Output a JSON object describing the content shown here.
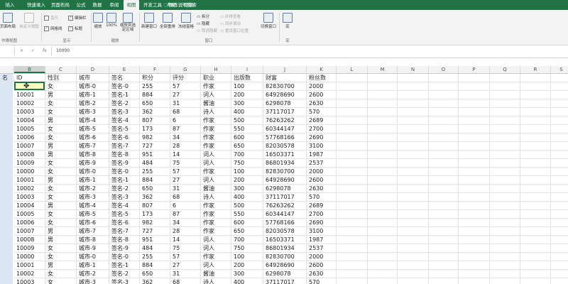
{
  "tabs": [
    {
      "label": "插入"
    },
    {
      "label": "快速录入"
    },
    {
      "label": "页面布局"
    },
    {
      "label": "公式"
    },
    {
      "label": "数据"
    },
    {
      "label": "审阅"
    },
    {
      "label": "视图",
      "active": true
    },
    {
      "label": "开发工具"
    },
    {
      "label": "帮助"
    },
    {
      "label": "团队"
    }
  ],
  "tell_me": "操作说明搜索",
  "ribbon": {
    "workbook_views": {
      "page_layout": "页面布局",
      "custom_views": "自定义视图",
      "pagebreak_view": "作簿视图"
    },
    "show": {
      "ruler": "直尺",
      "formula_bar": "编辑栏",
      "gridlines": "网格线",
      "headings": "标题",
      "group_label": "显示"
    },
    "zoom": {
      "zoom": "缩放",
      "zoom100": "100%",
      "zoom_selection": "缩放到选定区域",
      "group_label": "缩放"
    },
    "window": {
      "new_window": "新建窗口",
      "arrange_all": "全部重排",
      "freeze_panes": "冻结窗格",
      "split": "拆分",
      "hide": "隐藏",
      "unhide": "取消隐藏",
      "side_by_side": "并排查看",
      "sync_scroll": "同步滚动",
      "reset_pos": "重设窗口位置",
      "switch_windows": "切换窗口",
      "group_label": "窗口"
    },
    "macros": {
      "label": "宏",
      "group_label": "宏"
    }
  },
  "formula_bar": {
    "fx": "fx",
    "cancel": "×",
    "enter": "✓",
    "content": "10000"
  },
  "columns": [
    {
      "letter": "",
      "selected": false
    },
    {
      "letter": "B",
      "selected": true
    },
    {
      "letter": "C"
    },
    {
      "letter": "D"
    },
    {
      "letter": "E"
    },
    {
      "letter": "F"
    },
    {
      "letter": "G"
    },
    {
      "letter": "H"
    },
    {
      "letter": "I"
    },
    {
      "letter": "J"
    },
    {
      "letter": "K"
    },
    {
      "letter": "L"
    },
    {
      "letter": "M"
    },
    {
      "letter": "N"
    },
    {
      "letter": "O"
    },
    {
      "letter": "P"
    },
    {
      "letter": "Q"
    },
    {
      "letter": "R"
    },
    {
      "letter": "S"
    }
  ],
  "header_row": [
    "名",
    "ID",
    "性别",
    "城市",
    "签名",
    "积分",
    "评分",
    "职业",
    "出版数",
    "财富",
    "粉丝数"
  ],
  "rows": [
    [
      "10000",
      "女",
      "城市-0",
      "签名-0",
      "255",
      "57",
      "作家",
      "100",
      "82830700",
      "2000"
    ],
    [
      "10001",
      "男",
      "城市-1",
      "签名-1",
      "884",
      "27",
      "词人",
      "200",
      "64928690",
      "2600"
    ],
    [
      "10002",
      "女",
      "城市-2",
      "签名-2",
      "650",
      "31",
      "酱油",
      "300",
      "6298078",
      "2630"
    ],
    [
      "10003",
      "女",
      "城市-3",
      "签名-3",
      "362",
      "68",
      "诗人",
      "400",
      "37117017",
      "570"
    ],
    [
      "10004",
      "男",
      "城市-4",
      "签名-4",
      "807",
      "6",
      "作家",
      "500",
      "76263262",
      "2689"
    ],
    [
      "10005",
      "女",
      "城市-5",
      "签名-5",
      "173",
      "87",
      "作家",
      "550",
      "60344147",
      "2700"
    ],
    [
      "10006",
      "女",
      "城市-6",
      "签名-6",
      "982",
      "34",
      "作家",
      "600",
      "57768166",
      "2690"
    ],
    [
      "10007",
      "男",
      "城市-7",
      "签名-7",
      "727",
      "28",
      "作家",
      "650",
      "82030578",
      "3100"
    ],
    [
      "10008",
      "男",
      "城市-8",
      "签名-8",
      "951",
      "14",
      "词人",
      "700",
      "16503371",
      "1987"
    ],
    [
      "10009",
      "女",
      "城市-9",
      "签名-9",
      "484",
      "75",
      "词人",
      "750",
      "86801934",
      "2537"
    ],
    [
      "10000",
      "女",
      "城市-0",
      "签名-0",
      "255",
      "57",
      "作家",
      "100",
      "82830700",
      "2000"
    ],
    [
      "10001",
      "男",
      "城市-1",
      "签名-1",
      "884",
      "27",
      "词人",
      "200",
      "64928690",
      "2600"
    ],
    [
      "10002",
      "女",
      "城市-2",
      "签名-2",
      "650",
      "31",
      "酱油",
      "300",
      "6298078",
      "2630"
    ],
    [
      "10003",
      "女",
      "城市-3",
      "签名-3",
      "362",
      "68",
      "诗人",
      "400",
      "37117017",
      "570"
    ],
    [
      "10004",
      "男",
      "城市-4",
      "签名-4",
      "807",
      "6",
      "作家",
      "500",
      "76263262",
      "2689"
    ],
    [
      "10005",
      "女",
      "城市-5",
      "签名-5",
      "173",
      "87",
      "作家",
      "550",
      "60344147",
      "2700"
    ],
    [
      "10006",
      "女",
      "城市-6",
      "签名-6",
      "982",
      "34",
      "作家",
      "600",
      "57768166",
      "2690"
    ],
    [
      "10007",
      "男",
      "城市-7",
      "签名-7",
      "727",
      "28",
      "作家",
      "650",
      "82030578",
      "3100"
    ],
    [
      "10008",
      "男",
      "城市-8",
      "签名-8",
      "951",
      "14",
      "词人",
      "700",
      "16503371",
      "1987"
    ],
    [
      "10009",
      "女",
      "城市-9",
      "签名-9",
      "484",
      "75",
      "词人",
      "750",
      "86801934",
      "2537"
    ],
    [
      "10000",
      "女",
      "城市-0",
      "签名-0",
      "255",
      "57",
      "作家",
      "100",
      "82830700",
      "2000"
    ],
    [
      "10001",
      "男",
      "城市-1",
      "签名-1",
      "884",
      "27",
      "词人",
      "200",
      "64928690",
      "2600"
    ],
    [
      "10002",
      "女",
      "城市-2",
      "签名-2",
      "650",
      "31",
      "酱油",
      "300",
      "6298078",
      "2630"
    ],
    [
      "10003",
      "女",
      "城市-3",
      "签名-3",
      "362",
      "68",
      "诗人",
      "400",
      "37117017",
      "570"
    ]
  ]
}
